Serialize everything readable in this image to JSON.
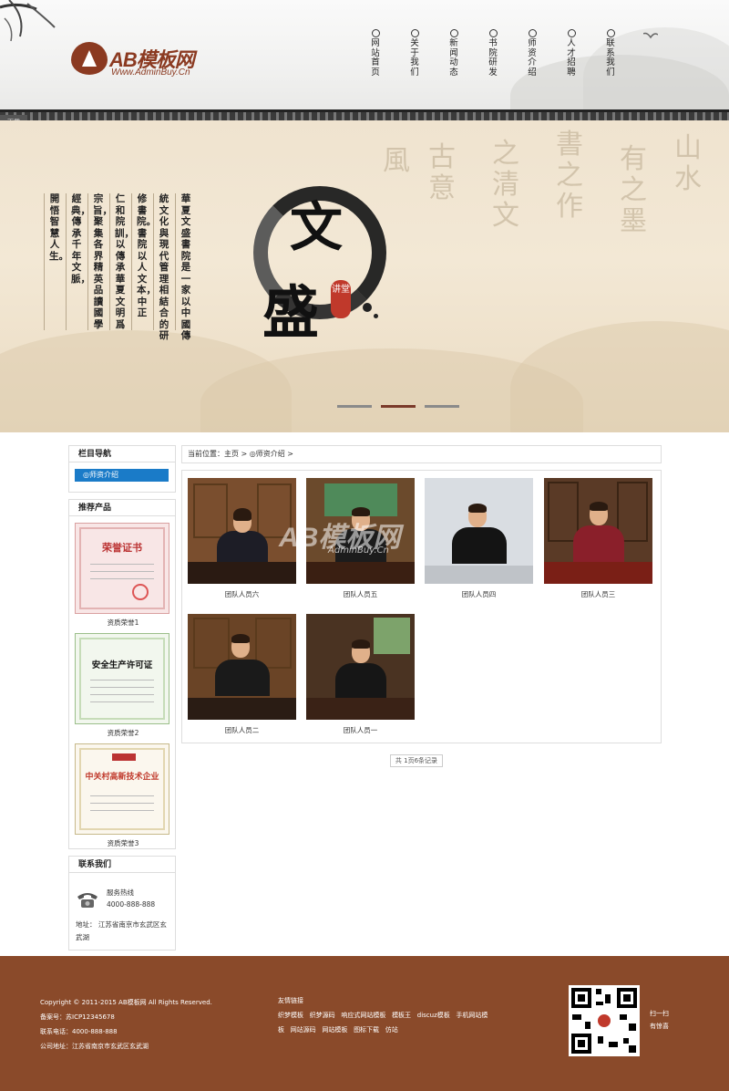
{
  "header": {
    "logo_name": "AB模板网",
    "logo_url": "Www.AdminBuy.Cn",
    "nav": [
      {
        "label": "网站首页"
      },
      {
        "label": "关于我们"
      },
      {
        "label": "新闻动态"
      },
      {
        "label": "书院研发"
      },
      {
        "label": "师资介绍"
      },
      {
        "label": "人才招聘"
      },
      {
        "label": "联系我们"
      }
    ],
    "tag": "下载"
  },
  "banner": {
    "text_columns": [
      "華夏文盛書院是一家以中國傳",
      "統文化與現代管理相結合的研",
      "修書院。書院以人文本，中正",
      "仁和院訓，以傳承華夏文明爲",
      "宗旨，聚集各界精英品讀國學",
      "經典，傳承千年文脈，",
      "開悟智慧人生。"
    ],
    "logo_char_1": "文",
    "logo_char_2": "盛",
    "seal_text": "讲堂",
    "slides": 3,
    "active_slide": 2
  },
  "sidebar": {
    "nav_title": "栏目导航",
    "nav_item": "◎师资介绍",
    "products_title": "推荐产品",
    "products": [
      {
        "caption": "资质荣誉1",
        "cert_title": "荣誉证书"
      },
      {
        "caption": "资质荣誉2",
        "cert_title": "安全生产许可证"
      },
      {
        "caption": "资质荣誉3",
        "cert_title": "中关村高新技术企业"
      }
    ],
    "contact_title": "联系我们",
    "hotline_label": "服务热线",
    "hotline": "4000-888-888",
    "address": "地址：  江苏省南京市玄武区玄武湖"
  },
  "main": {
    "breadcrumb": "当前位置：主页 > ◎师资介绍 >",
    "photos": [
      {
        "caption": "团队人员六"
      },
      {
        "caption": "团队人员五"
      },
      {
        "caption": "团队人员四"
      },
      {
        "caption": "团队人员三"
      },
      {
        "caption": "团队人员二"
      },
      {
        "caption": "团队人员一"
      }
    ],
    "watermark": "AB模板网",
    "watermark_url": "AdminBuy.Cn",
    "pager": "共 1页6条记录"
  },
  "footer": {
    "copyright": "Copyright © 2011-2015 AB模板网 All Rights Reserved.",
    "icp": "备案号：苏ICP12345678",
    "phone": "联系电话：4000-888-888",
    "address": "公司地址：江苏省南京市玄武区玄武湖",
    "links_title": "友情链接",
    "links_row1": [
      "织梦模板",
      "织梦源码",
      "响应式网站模板",
      "模板王",
      "discuz模板",
      "手机网站模"
    ],
    "links_row2": [
      "板",
      "网站源码",
      "网站模板",
      "图标下载",
      "仿站"
    ],
    "qr_label_1": "扫一扫",
    "qr_label_2": "有惊喜"
  }
}
